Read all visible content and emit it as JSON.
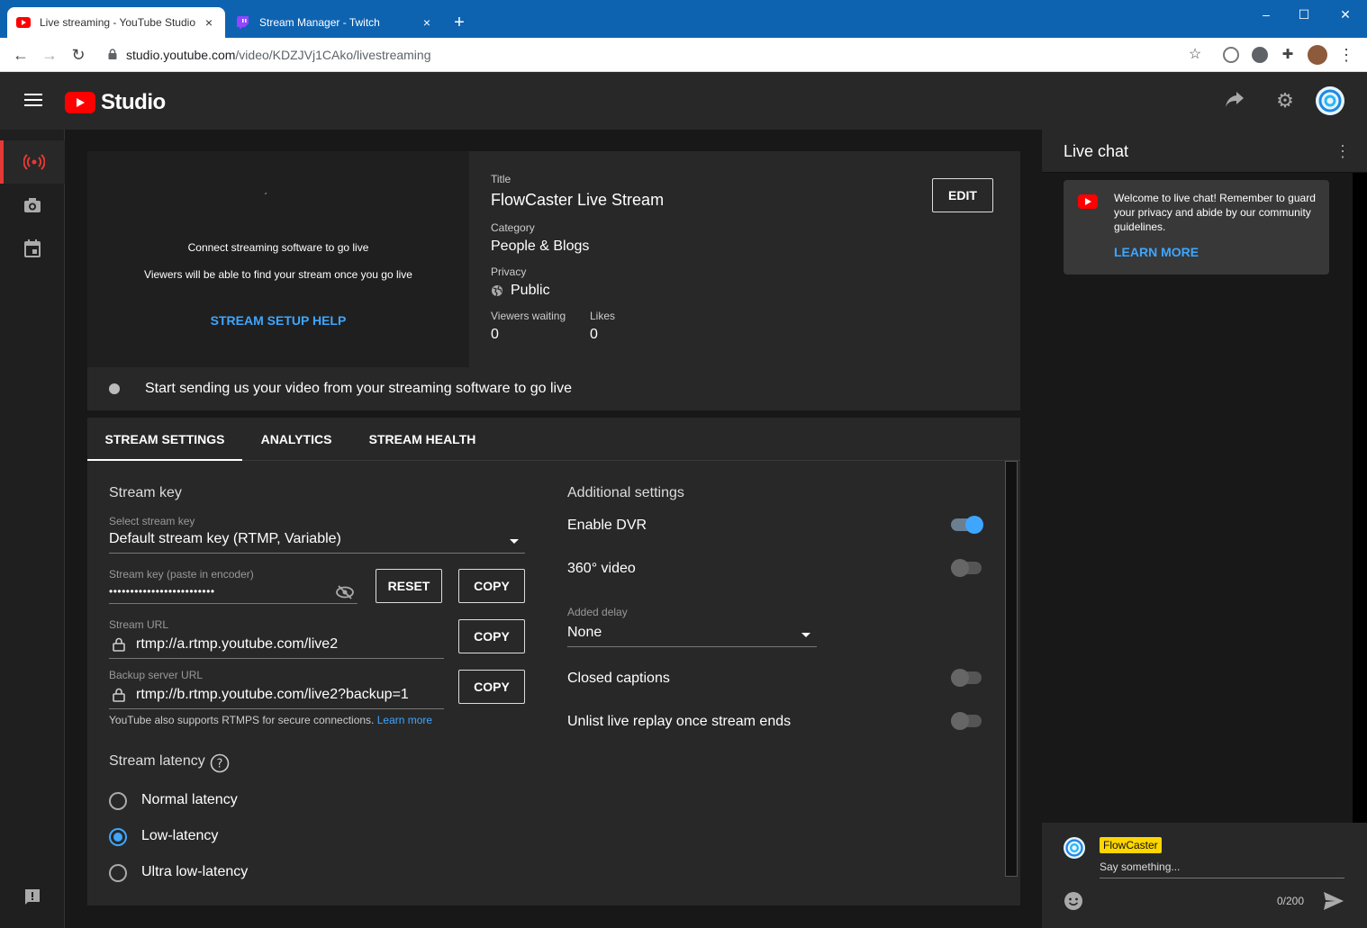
{
  "browser": {
    "tabs": [
      {
        "title": "Live streaming - YouTube Studio",
        "close": "×"
      },
      {
        "title": "Stream Manager - Twitch",
        "close": "×"
      }
    ],
    "new_tab": "+",
    "url_host": "studio.youtube.com",
    "url_path": "/video/KDZJVj1CAko/livestreaming",
    "window_controls": [
      "–",
      "☐",
      "✕"
    ]
  },
  "header": {
    "app_name": "Studio"
  },
  "preview": {
    "line1": "Connect streaming software to go live",
    "line2": "Viewers will be able to find your stream once you go live",
    "help": "STREAM SETUP HELP"
  },
  "details": {
    "title_label": "Title",
    "title": "FlowCaster Live Stream",
    "category_label": "Category",
    "category": "People & Blogs",
    "privacy_label": "Privacy",
    "privacy": "Public",
    "viewers_label": "Viewers waiting",
    "viewers": "0",
    "likes_label": "Likes",
    "likes": "0",
    "edit": "EDIT"
  },
  "status": {
    "message": "Start sending us your video from your streaming software to go live"
  },
  "tabs": [
    "STREAM SETTINGS",
    "ANALYTICS",
    "STREAM HEALTH"
  ],
  "stream_key": {
    "section": "Stream key",
    "select_label": "Select stream key",
    "select_value": "Default stream key (RTMP, Variable)",
    "key_label": "Stream key (paste in encoder)",
    "key_value": "•••••••••••••••••••••••••",
    "reset": "RESET",
    "copy": "COPY",
    "url_label": "Stream URL",
    "url_value": "rtmp://a.rtmp.youtube.com/live2",
    "backup_label": "Backup server URL",
    "backup_value": "rtmp://b.rtmp.youtube.com/live2?backup=1",
    "note": "YouTube also supports RTMPS for secure connections.",
    "note_link": "Learn more"
  },
  "latency": {
    "section": "Stream latency",
    "options": [
      "Normal latency",
      "Low-latency",
      "Ultra low-latency"
    ],
    "selected": "Low-latency"
  },
  "additional": {
    "section": "Additional settings",
    "dvr": "Enable DVR",
    "dvr_on": true,
    "video360": "360° video",
    "video360_on": false,
    "delay_label": "Added delay",
    "delay_value": "None",
    "captions": "Closed captions",
    "captions_on": false,
    "unlist": "Unlist live replay once stream ends",
    "unlist_on": false
  },
  "chat": {
    "title": "Live chat",
    "welcome": "Welcome to live chat! Remember to guard your privacy and abide by our community guidelines.",
    "learn_more": "LEARN MORE",
    "user": "FlowCaster",
    "placeholder": "Say something...",
    "counter": "0/200"
  },
  "colors": {
    "accent": "#3ea6ff",
    "youtube_red": "#ff0000",
    "name_badge": "#ffd600"
  }
}
